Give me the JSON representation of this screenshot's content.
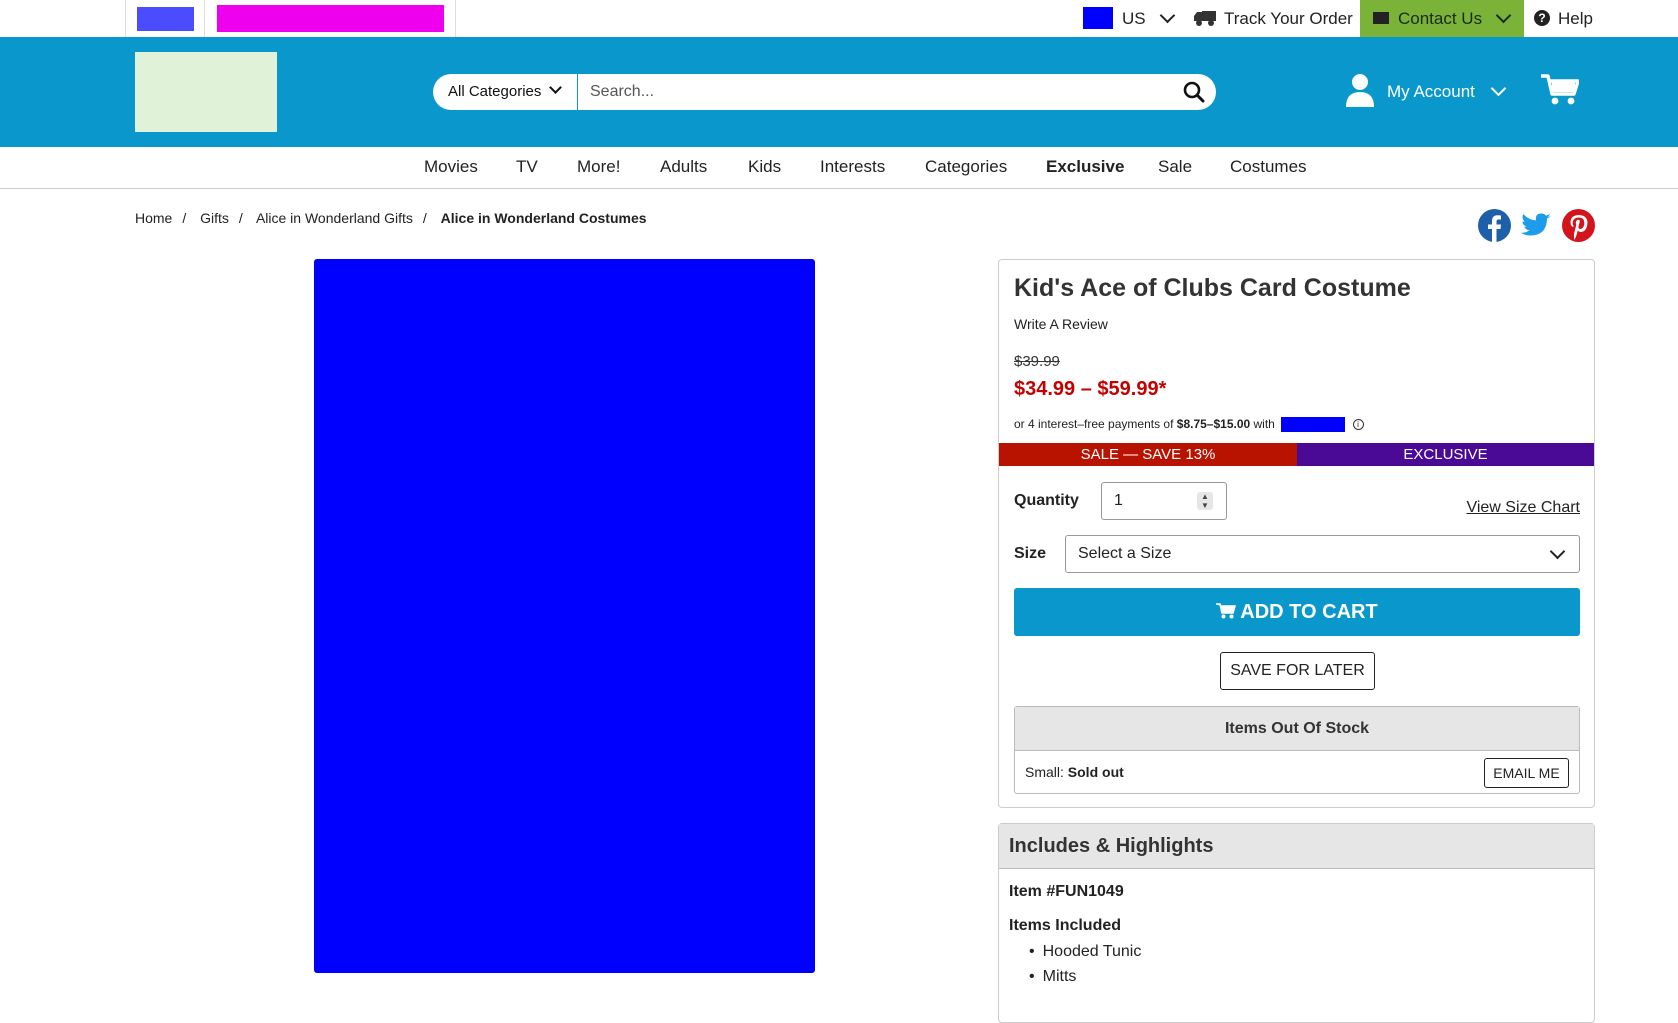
{
  "topbar": {
    "country": "US",
    "track_order": "Track Your Order",
    "contact_us": "Contact Us",
    "help": "Help"
  },
  "header": {
    "category_label": "All Categories",
    "search_placeholder": "Search...",
    "account_label": "My Account"
  },
  "nav": {
    "items": [
      "Movies",
      "TV",
      "More!",
      "Adults",
      "Kids",
      "Interests",
      "Categories",
      "Exclusive",
      "Sale",
      "Costumes"
    ]
  },
  "breadcrumb": {
    "items": [
      "Home",
      "Gifts",
      "Alice in Wonderland Gifts",
      "Alice in Wonderland Costumes"
    ]
  },
  "product": {
    "title": "Kid's Ace of Clubs Card Costume",
    "write_review": "Write A Review",
    "original_price": "$39.99",
    "price_range": "$34.99 – $59.99*",
    "payment_prefix": "or 4 interest–free payments of",
    "payment_amount": "$8.75–$15.00",
    "payment_with": "with",
    "sale_badge": "SALE — SAVE 13%",
    "exclusive_badge": "EXCLUSIVE",
    "quantity_label": "Quantity",
    "quantity_value": "1",
    "size_chart_link": "View Size Chart",
    "size_label": "Size",
    "size_value": "Select a Size",
    "add_to_cart": "ADD TO CART",
    "save_for_later": "SAVE FOR LATER",
    "out_of_stock_title": "Items Out Of Stock",
    "oos_size": "Small:",
    "oos_status": "Sold out",
    "email_me": "EMAIL ME"
  },
  "highlights": {
    "title": "Includes & Highlights",
    "item_number": "Item #FUN1049",
    "included_label": "Items Included",
    "included": [
      "Hooded Tunic",
      "Mitts"
    ]
  },
  "colors": {
    "brand_blue": "#0a97cc",
    "contact_green": "#7ab337",
    "sale_red": "#b81300",
    "exclusive_purple": "#4a0a96",
    "price_red": "#c40000"
  },
  "icons": [
    "truck-icon",
    "envelope-icon",
    "help-icon",
    "search-icon",
    "account-icon",
    "cart-icon",
    "facebook-icon",
    "twitter-icon",
    "pinterest-icon",
    "info-icon"
  ]
}
